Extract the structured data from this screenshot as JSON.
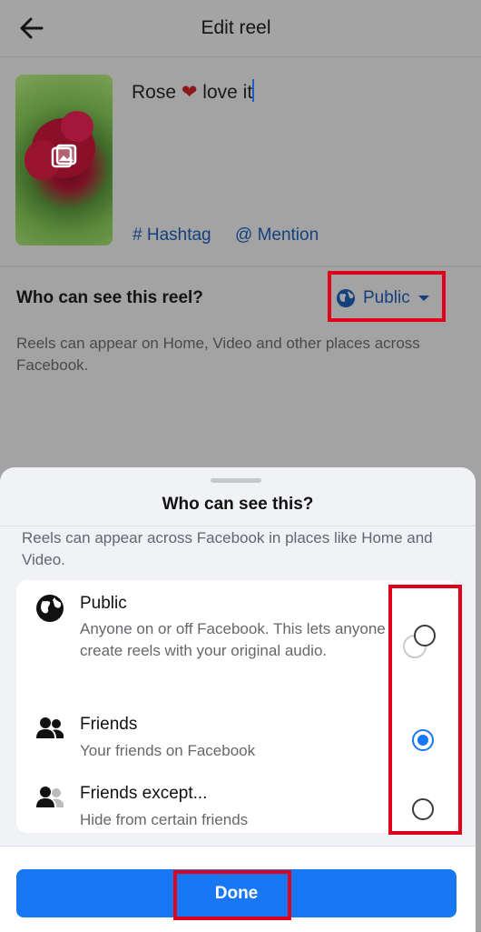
{
  "header": {
    "title": "Edit reel"
  },
  "post": {
    "caption_before": "Rose ",
    "caption_heart": "❤",
    "caption_after": " love it",
    "hashtag_label": "# Hashtag",
    "mention_label": "@ Mention"
  },
  "audience": {
    "label": "Who can see this reel?",
    "selected": "Public",
    "description": "Reels can appear on Home, Video and other places across Facebook."
  },
  "sheet": {
    "title": "Who can see this?",
    "description": "Reels can appear across Facebook in places like Home and Video.",
    "options": [
      {
        "label": "Public",
        "description": "Anyone on or off Facebook. This lets anyone create reels with your original audio.",
        "icon": "globe-icon",
        "selected": false
      },
      {
        "label": "Friends",
        "description": "Your friends on Facebook",
        "icon": "friends-icon",
        "selected": true
      },
      {
        "label": "Friends except...",
        "description": "Hide from certain friends",
        "icon": "friends-except-icon",
        "selected": false
      }
    ],
    "done_label": "Done"
  },
  "colors": {
    "accent": "#1877f2",
    "highlight_box": "#e0001b",
    "link": "#15407e"
  }
}
